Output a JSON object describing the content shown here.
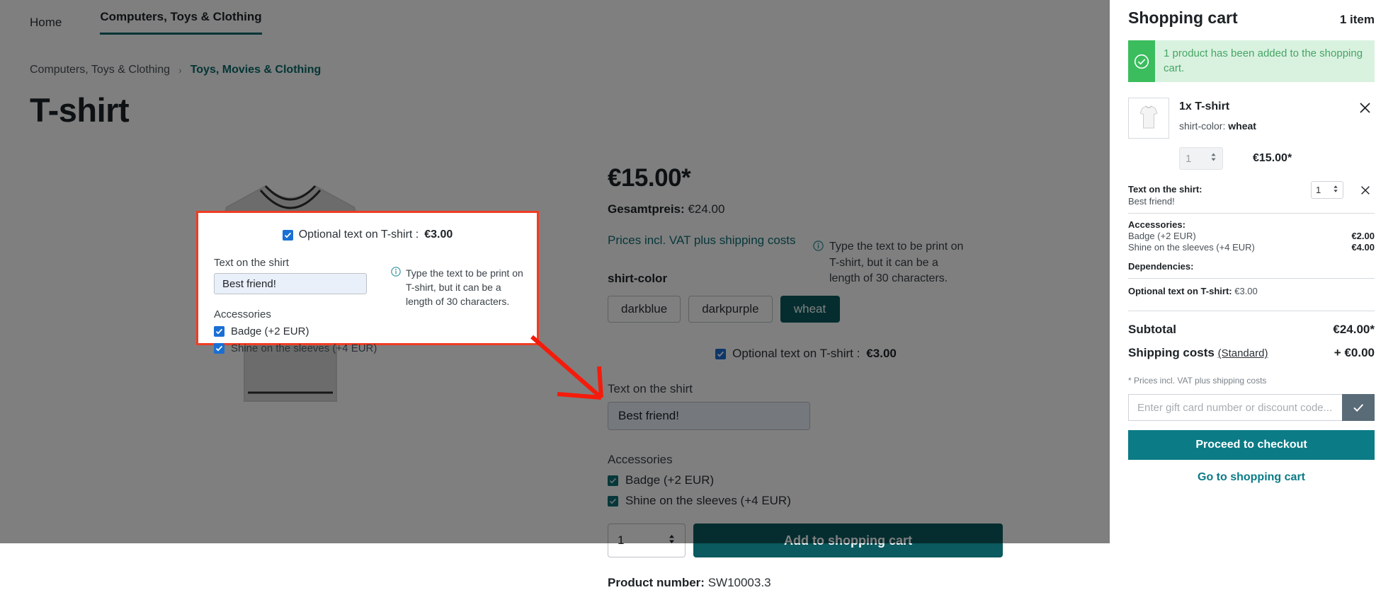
{
  "nav": {
    "items": [
      {
        "label": "Home",
        "active": false
      },
      {
        "label": "Computers, Toys & Clothing",
        "active": true
      }
    ]
  },
  "breadcrumb": {
    "parent": "Computers, Toys & Clothing",
    "separator": "›",
    "current": "Toys, Movies & Clothing"
  },
  "page": {
    "title": "T-shirt"
  },
  "product": {
    "price": "€15.00*",
    "total_price_label": "Gesamtpreis:",
    "total_price_value": "€24.00",
    "vat_note": "Prices incl. VAT plus shipping costs",
    "color_group_label": "shirt-color",
    "colors": [
      {
        "label": "darkblue",
        "selected": false
      },
      {
        "label": "darkpurple",
        "selected": false
      },
      {
        "label": "wheat",
        "selected": true
      }
    ],
    "optional_text_label": "Optional text on T-shirt :",
    "optional_text_price": "€3.00",
    "text_field_label": "Text on the shirt",
    "text_field_value": "Best friend!",
    "hint": "Type the text to be print on T-shirt, but it can be a length of 30 characters.",
    "accessories_label": "Accessories",
    "accessories": [
      {
        "label": "Badge (+2 EUR)",
        "checked": true
      },
      {
        "label": "Shine on the sleeves (+4 EUR)",
        "checked": true
      }
    ],
    "quantity": "1",
    "add_to_cart_label": "Add to shopping cart",
    "product_number_label": "Product number:",
    "product_number_value": "SW10003.3"
  },
  "callout": {
    "optional_text_label": "Optional text on T-shirt :",
    "optional_text_price": "€3.00",
    "text_field_label": "Text on the shirt",
    "text_field_value": "Best friend!",
    "hint": "Type the text to be print on T-shirt, but it can be a length of 30 characters.",
    "accessories_label": "Accessories",
    "accessories": [
      {
        "label": "Badge (+2 EUR)",
        "checked": true
      },
      {
        "label": "Shine on the sleeves (+4 EUR)",
        "checked": true
      }
    ],
    "border_color": "#f03c23"
  },
  "cart": {
    "title": "Shopping cart",
    "item_count": "1 item",
    "alert": "1 product has been added to the shopping cart.",
    "item": {
      "name": "1x T-shirt",
      "variant_label": "shirt-color:",
      "variant_value": "wheat",
      "quantity": "1",
      "line_price": "€15.00*"
    },
    "option_text": {
      "label": "Text on the shirt:",
      "value": "Best friend!",
      "quantity": "1"
    },
    "accessories": {
      "label": "Accessories:",
      "rows": [
        {
          "label": "Badge (+2 EUR)",
          "price": "€2.00"
        },
        {
          "label": "Shine on the sleeves (+4 EUR)",
          "price": "€4.00"
        }
      ]
    },
    "dependencies_label": "Dependencies:",
    "optional_summary_label": "Optional text on T-shirt:",
    "optional_summary_value": "€3.00",
    "subtotal_label": "Subtotal",
    "subtotal_value": "€24.00*",
    "shipping_label": "Shipping costs",
    "shipping_method": "(Standard)",
    "shipping_value": "+ €0.00",
    "vat_note": "* Prices incl. VAT plus shipping costs",
    "voucher_placeholder": "Enter gift card number or discount code...",
    "voucher_value": "",
    "checkout_label": "Proceed to checkout",
    "go_to_cart_label": "Go to shopping cart"
  },
  "colors": {
    "accent": "#0a5a5f",
    "link": "#0b7b86",
    "success": "#3bbd5e",
    "callout_border": "#f03c23"
  }
}
